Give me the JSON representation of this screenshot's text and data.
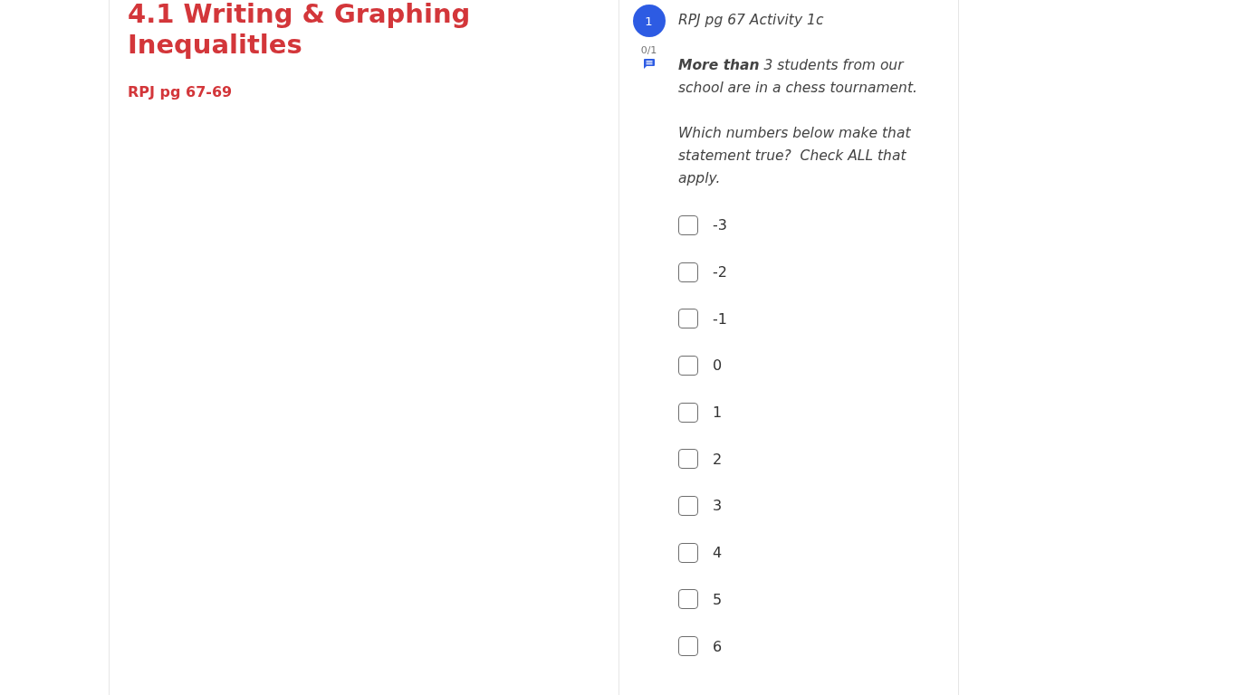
{
  "lesson": {
    "title": "4.1 Writing & Graphing Inequalitles",
    "subtitle": "RPJ pg 67-69"
  },
  "question": {
    "number": "1",
    "score": "0/1",
    "header": "RPJ pg 67 Activity 1c",
    "prompt": [
      "**More than** 3 students from our school are in a chess tournament.",
      "Which numbers below make that statement true?  Check ALL that apply."
    ],
    "options": [
      {
        "label": "-3",
        "checked": false
      },
      {
        "label": "-2",
        "checked": false
      },
      {
        "label": "-1",
        "checked": false
      },
      {
        "label": "0",
        "checked": false
      },
      {
        "label": "1",
        "checked": false
      },
      {
        "label": "2",
        "checked": false
      },
      {
        "label": "3",
        "checked": false
      },
      {
        "label": "4",
        "checked": false
      },
      {
        "label": "5",
        "checked": false
      },
      {
        "label": "6",
        "checked": false
      }
    ]
  }
}
